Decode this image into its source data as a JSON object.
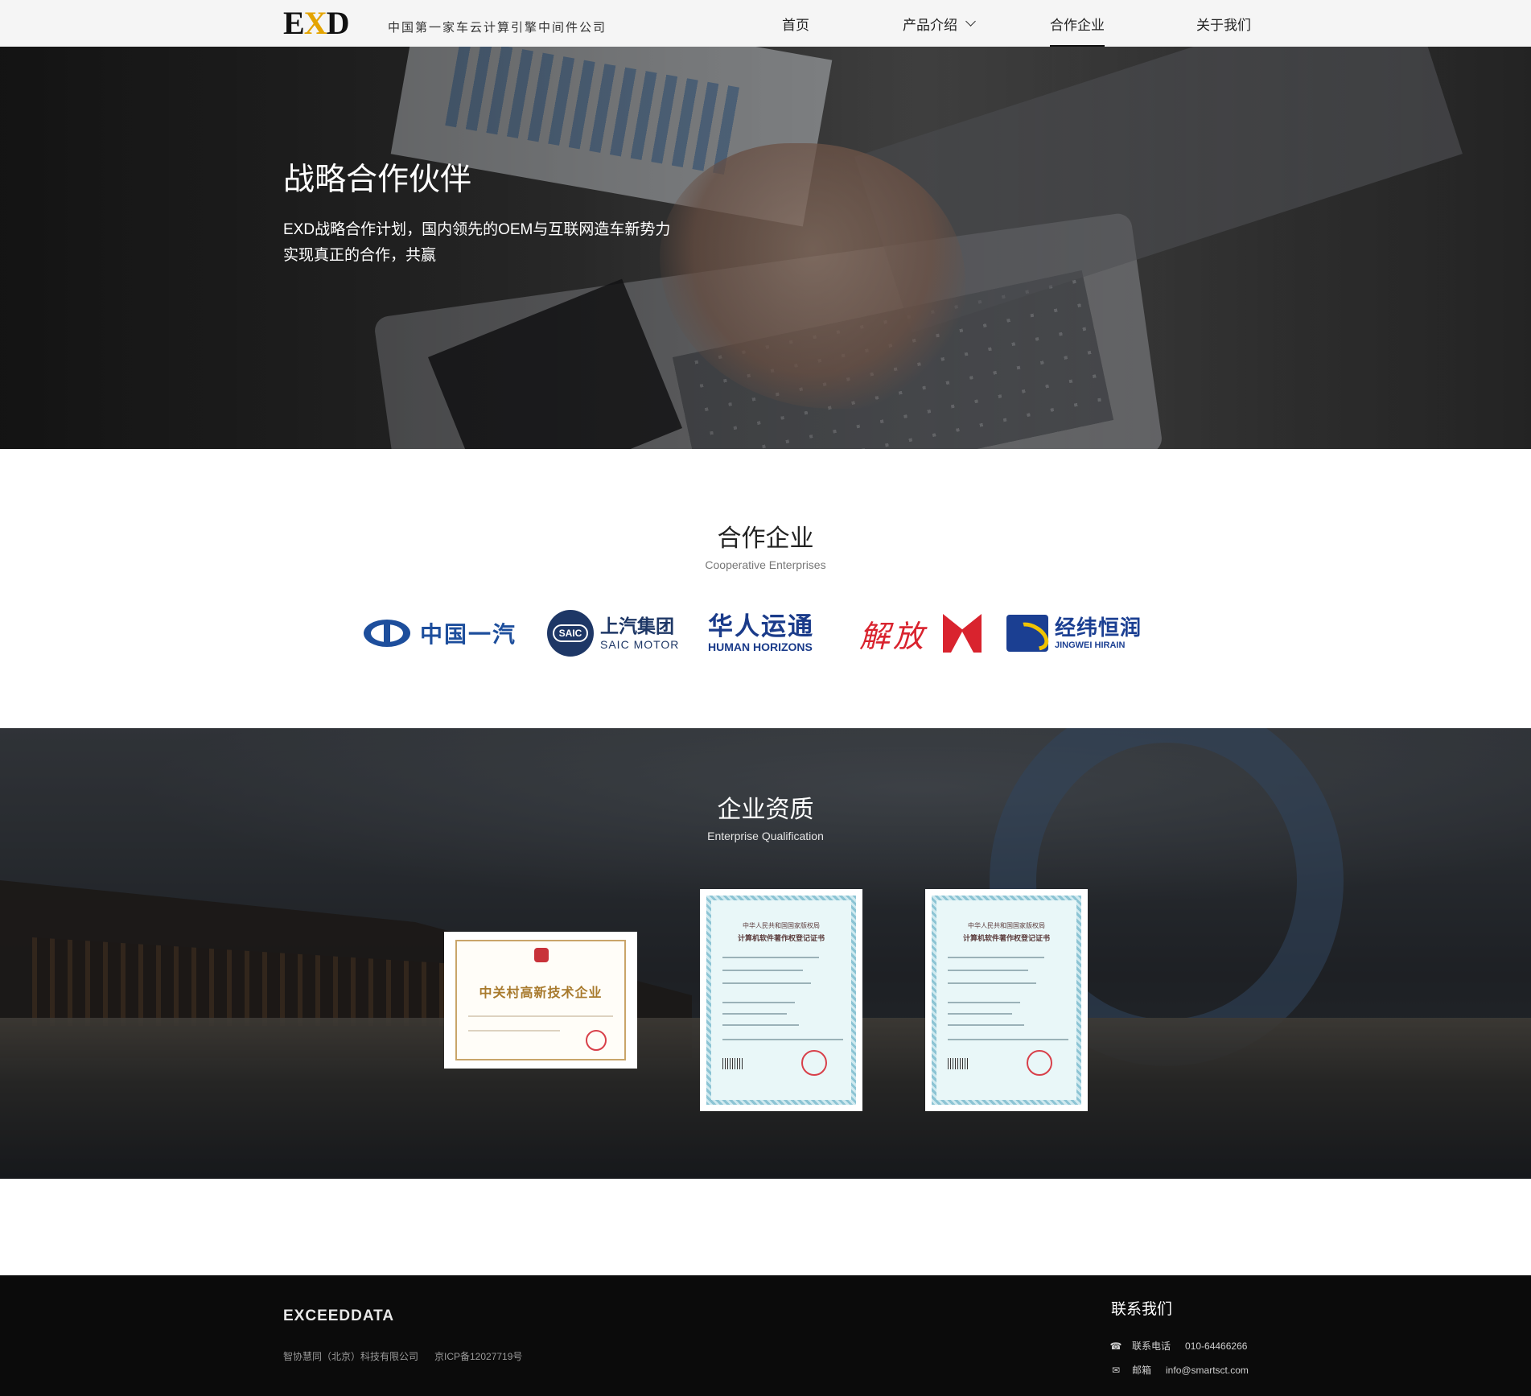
{
  "header": {
    "logo": {
      "pre": "E",
      "x": "X",
      "post": "D"
    },
    "tagline": "中国第一家车云计算引擎中间件公司",
    "nav": [
      {
        "label": "首页",
        "active": false
      },
      {
        "label": "产品介绍",
        "active": false,
        "has_dropdown": true
      },
      {
        "label": "合作企业",
        "active": true
      },
      {
        "label": "关于我们",
        "active": false
      }
    ]
  },
  "hero": {
    "title": "战略合作伙伴",
    "desc_line1": "EXD战略合作计划，国内领先的OEM与互联网造车新势力",
    "desc_line2": "实现真正的合作，共赢"
  },
  "partners": {
    "title": "合作企业",
    "subtitle": "Cooperative Enterprises",
    "logos": [
      {
        "name": "中国一汽",
        "icon": "faw-emblem-icon",
        "color": "#1d4e9c"
      },
      {
        "name": "上汽集团",
        "name_en": "SAIC MOTOR",
        "badge": "SAIC",
        "icon": "saic-emblem-icon",
        "color": "#1e3766"
      },
      {
        "name": "华人运通",
        "name_en": "HUMAN HORIZONS",
        "color": "#1a3b8a"
      },
      {
        "name": "解放",
        "icon": "jiefang-emblem-icon",
        "color": "#d9232e"
      },
      {
        "name": "经纬恒润",
        "name_en": "JINGWEI HIRAIN",
        "icon": "jingwei-emblem-icon",
        "color": "#1b3f92"
      }
    ]
  },
  "qualification": {
    "title": "企业资质",
    "subtitle": "Enterprise Qualification",
    "certs": [
      {
        "title": "中关村高新技术企业"
      },
      {
        "head1": "中华人民共和国国家版权局",
        "head2": "计算机软件著作权登记证书"
      },
      {
        "head1": "中华人民共和国国家版权局",
        "head2": "计算机软件著作权登记证书"
      }
    ]
  },
  "footer": {
    "logo": "EXCEEDDATA",
    "company": "智协慧同（北京）科技有限公司",
    "icp": "京ICP备12027719号",
    "contact_title": "联系我们",
    "phone_label": "联系电话",
    "phone": "010-64466266",
    "email_label": "邮箱",
    "email": "info@smartsct.com",
    "icons": {
      "phone": "phone-icon",
      "email": "mail-icon"
    }
  }
}
